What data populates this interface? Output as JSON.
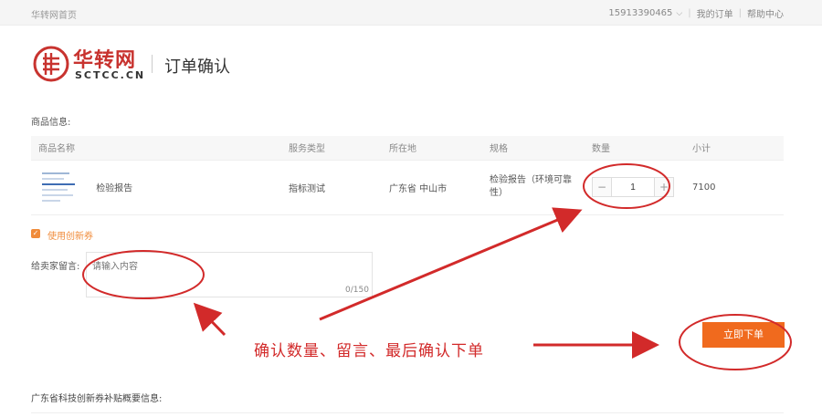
{
  "topbar": {
    "home": "华转网首页",
    "phone": "15913390465",
    "my_orders": "我的订单",
    "help_center": "帮助中心"
  },
  "brand": {
    "name_cn": "华转网",
    "name_en": "SCTCC.CN",
    "accent": "#c8332f"
  },
  "page": {
    "title": "订单确认"
  },
  "goods": {
    "section_label": "商品信息:",
    "columns": [
      "商品名称",
      "服务类型",
      "所在地",
      "规格",
      "数量",
      "小计"
    ],
    "row": {
      "name": "检验报告",
      "service_type": "指标测试",
      "location": "广东省 中山市",
      "spec": "检验报告（环境可靠性）",
      "quantity": "1",
      "subtotal": "7100"
    },
    "minus_symbol": "−",
    "plus_symbol": "+"
  },
  "voucher": {
    "label": "使用创新券",
    "checked": true,
    "color": "#f08c3b"
  },
  "message": {
    "label": "给卖家留言:",
    "placeholder": "请输入内容",
    "counter": "0/150"
  },
  "submit": {
    "label": "立即下单",
    "color": "#f06a1e"
  },
  "annotation": {
    "text": "确认数量、留言、最后确认下单",
    "color": "#d22a2a"
  },
  "bottom": {
    "section_label": "广东省科技创新券补贴概要信息:"
  }
}
